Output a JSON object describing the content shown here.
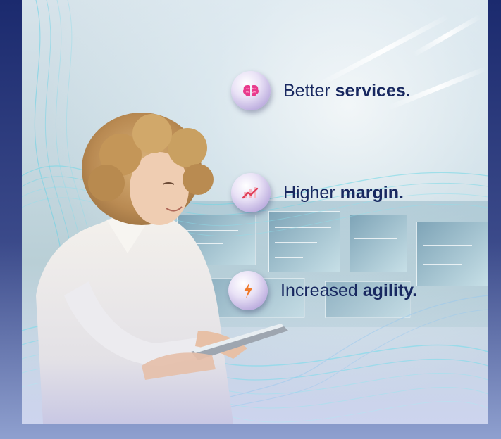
{
  "features": [
    {
      "regular": "Better",
      "bold": "services.",
      "icon": "brain-icon",
      "icon_color": "#e83a8c"
    },
    {
      "regular": "Higher",
      "bold": "margin.",
      "icon": "trend-chart-icon",
      "icon_color": "#e0405a"
    },
    {
      "regular": "Increased",
      "bold": "agility.",
      "icon": "lightning-bolt-icon",
      "icon_color": "#f07a2a"
    }
  ],
  "colors": {
    "background": "#1b2a6e",
    "text": "#182860",
    "icon_circle": "#b8a8dc"
  }
}
